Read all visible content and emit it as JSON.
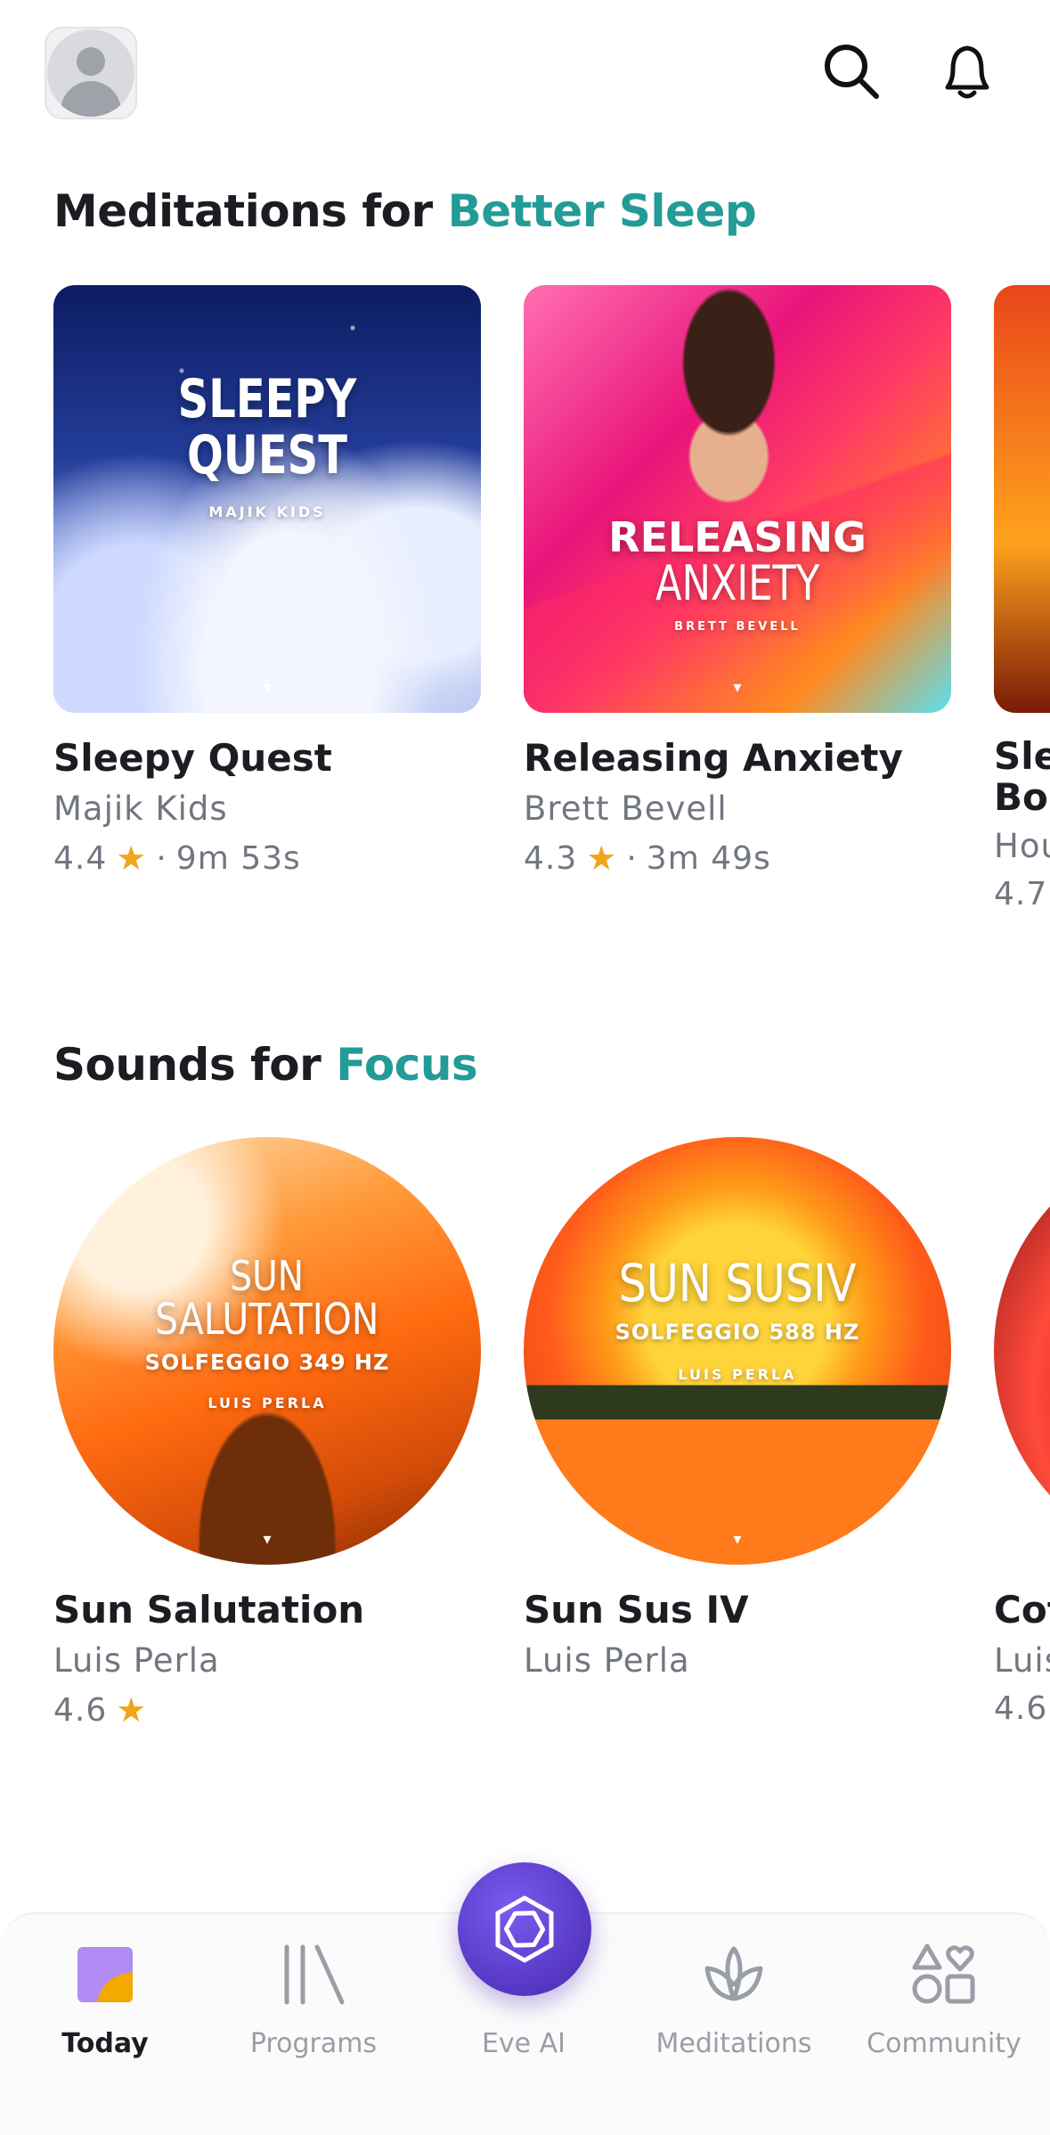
{
  "header": {
    "avatar_icon": "profile-avatar-icon",
    "search_icon": "search-icon",
    "bell_icon": "bell-icon"
  },
  "sleep_section": {
    "title_prefix": "Meditations for",
    "title_accent": "Better Sleep",
    "accent_color": "#239b97",
    "cards": [
      {
        "art_title": "SLEEPY QUEST",
        "art_subtitle": "MAJIK KIDS",
        "title": "Sleepy Quest",
        "author": "Majik Kids",
        "rating": "4.4",
        "duration": "9m 53s"
      },
      {
        "art_title_line1": "RELEASING",
        "art_title_line2": "ANXIETY",
        "art_subtitle": "BRETT BEVELL",
        "title": "Releasing Anxiety",
        "author": "Brett Bevell",
        "rating": "4.3",
        "duration": "3m 49s"
      },
      {
        "title_line1": "Sle",
        "title_line2": "Bo",
        "author": "Hou",
        "rating": "4.7"
      }
    ]
  },
  "focus_section": {
    "title_prefix": "Sounds for",
    "title_accent": "Focus",
    "cards": [
      {
        "art_title_line1": "SUN",
        "art_title_line2": "SALUTATION",
        "art_subtitle": "SOLFEGGIO 349 HZ",
        "art_author": "LUIS PERLA",
        "title": "Sun Salutation",
        "author": "Luis Perla",
        "rating": "4.6"
      },
      {
        "art_title": "SUN SUSIV",
        "art_subtitle": "SOLFEGGIO 588 HZ",
        "art_author": "LUIS PERLA",
        "title": "Sun Sus IV",
        "author": "Luis Perla"
      },
      {
        "title": "Cof",
        "author": "Luis",
        "rating": "4.6"
      }
    ]
  },
  "star_color": "#f0a51c",
  "separator": "·",
  "nav": {
    "items": [
      {
        "label": "Today",
        "icon": "today-icon",
        "active": true
      },
      {
        "label": "Programs",
        "icon": "programs-icon"
      },
      {
        "label": "Eve AI",
        "icon": "eve-ai-icon"
      },
      {
        "label": "Meditations",
        "icon": "lotus-icon"
      },
      {
        "label": "Community",
        "icon": "community-shapes-icon"
      }
    ]
  }
}
